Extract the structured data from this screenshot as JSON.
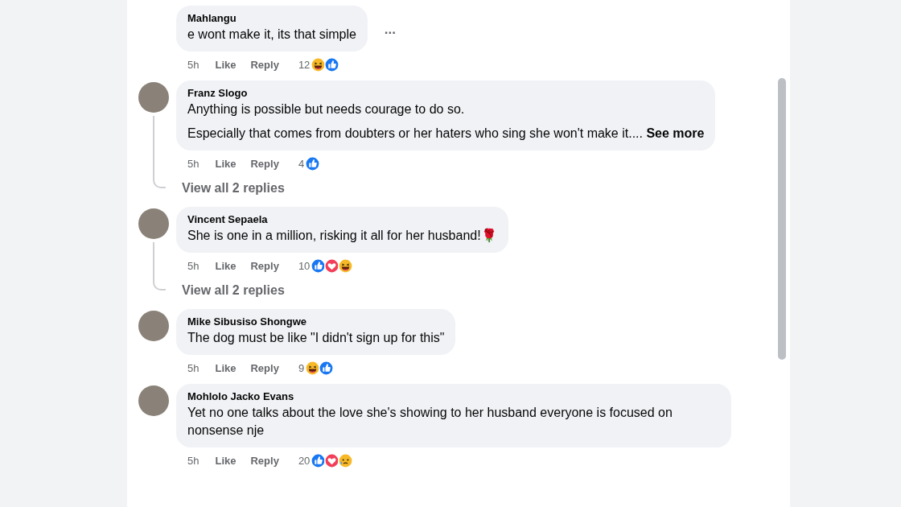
{
  "comments": [
    {
      "author": "Mahlangu",
      "avatar": false,
      "paragraphs": [
        "e wont make it, its that simple"
      ],
      "time": "5h",
      "like": "Like",
      "reply": "Reply",
      "count": "12",
      "reactions": [
        {
          "kind": "haha"
        },
        {
          "kind": "like"
        }
      ],
      "more": "..."
    },
    {
      "author": "Franz Slogo",
      "avatar": true,
      "paragraphs": [
        "Anything is possible but needs courage to do so.",
        "Especially that comes from doubters or her haters who sing she won't make it.... **See more**"
      ],
      "time": "5h",
      "like": "Like",
      "reply": "Reply",
      "count": "4",
      "reactions": [
        {
          "kind": "like"
        }
      ],
      "view_replies": "View all 2 replies"
    },
    {
      "author": "Vincent Sepaela",
      "avatar": true,
      "paragraphs": [
        "She is one in a million, risking it all for her husband!🌹"
      ],
      "time": "5h",
      "like": "Like",
      "reply": "Reply",
      "count": "10",
      "reactions": [
        {
          "kind": "like"
        },
        {
          "kind": "love"
        },
        {
          "kind": "haha"
        }
      ],
      "view_replies": "View all 2 replies"
    },
    {
      "author": "Mike Sibusiso Shongwe",
      "avatar": true,
      "paragraphs": [
        "The dog must be like \"I didn't sign up for this\""
      ],
      "time": "5h",
      "like": "Like",
      "reply": "Reply",
      "count": "9",
      "reactions": [
        {
          "kind": "haha"
        },
        {
          "kind": "like"
        }
      ]
    },
    {
      "author": "Mohlolo Jacko Evans",
      "avatar": true,
      "paragraphs": [
        "Yet no one talks about the love she's showing to her husband everyone is focused on nonsense nje"
      ],
      "time": "5h",
      "like": "Like",
      "reply": "Reply",
      "count": "20",
      "reactions": [
        {
          "kind": "like"
        },
        {
          "kind": "love"
        },
        {
          "kind": "sad"
        }
      ]
    }
  ]
}
